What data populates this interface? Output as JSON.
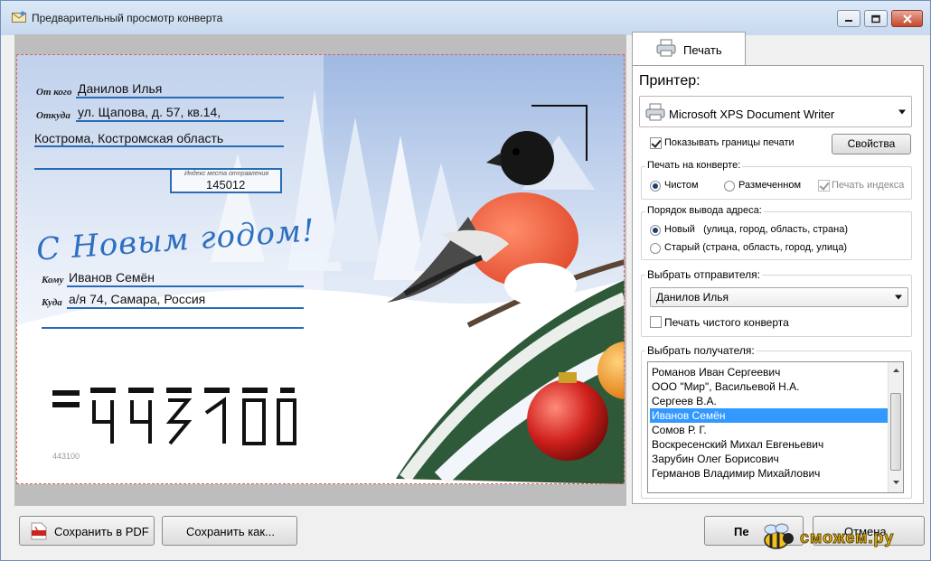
{
  "window": {
    "title": "Предварительный просмотр конверта"
  },
  "envelope": {
    "from_label": "От кого",
    "from_value": "Данилов Илья",
    "where_label": "Откуда",
    "where_value": "ул. Щапова, д. 57, кв.14,",
    "where_value2": "Кострома, Костромская область",
    "index_caption": "Индекс места отправления",
    "index_value": "145012",
    "greeting": "С Новым годом!",
    "to_label": "Кому",
    "to_value": "Иванов Семён",
    "dest_label": "Куда",
    "dest_value": "а/я 74, Самара, Россия",
    "postcode_digits": "443100"
  },
  "panel": {
    "tab_label": "Печать",
    "printer_label": "Принтер:",
    "printer_value": "Microsoft XPS Document Writer",
    "show_borders_label": "Показывать границы печати",
    "show_borders_checked": true,
    "properties_button": "Свойства",
    "print_on_envelope_label": "Печать на конверте:",
    "clean_label": "Чистом",
    "marked_label": "Размеченном",
    "print_index_label": "Печать индекса",
    "address_order_label": "Порядок вывода адреса:",
    "new_order_label": "Новый   (улица, город, область, страна)",
    "old_order_label": "Старый (страна, область, город, улица)",
    "sender_label": "Выбрать отправителя:",
    "sender_value": "Данилов Илья",
    "clean_envelope_label": "Печать чистого конверта",
    "recipient_label": "Выбрать получателя:",
    "recipients": [
      "Романов Иван Сергеевич",
      "ООО \"Мир\", Васильевой Н.А.",
      "Сергеев В.А.",
      "Иванов Семён",
      "Сомов Р. Г.",
      "Воскресенский Михал Евгеньевич",
      "Зарубин Олег Борисович",
      "Германов Владимир Михайлович"
    ],
    "selected_recipient_index": 3
  },
  "footer": {
    "save_pdf": "Сохранить в PDF",
    "save_as": "Сохранить как...",
    "print": "Пе",
    "cancel": "Отмена"
  },
  "watermark": {
    "text": "сможем.ру"
  },
  "colors": {
    "accent": "#3399ff",
    "envelope_line": "#2a6bb8",
    "greeting": "#2f6fc1"
  }
}
